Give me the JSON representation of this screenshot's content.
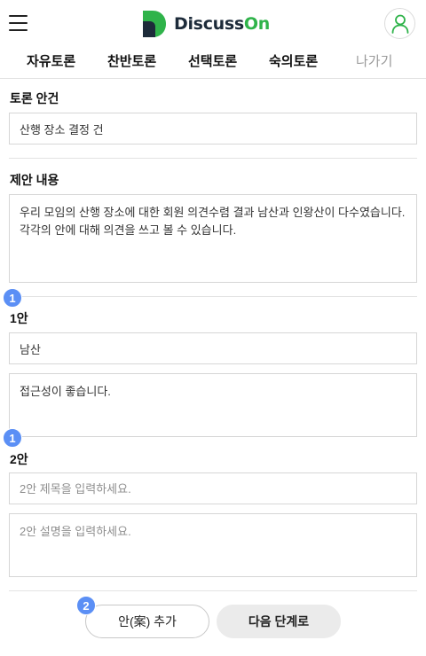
{
  "header": {
    "logo_text_main": "Discuss",
    "logo_text_accent": "On",
    "colors": {
      "brand_green": "#2fb34a",
      "brand_navy": "#1d2b3a"
    },
    "icons": {
      "menu": "hamburger-icon",
      "profile": "user-icon"
    }
  },
  "tabs": [
    {
      "label": "자유토론"
    },
    {
      "label": "찬반토론"
    },
    {
      "label": "선택토론"
    },
    {
      "label": "숙의토론"
    },
    {
      "label": "나가기"
    }
  ],
  "topic": {
    "label": "토론 안건",
    "value": "산행 장소 결정 건"
  },
  "proposal": {
    "label": "제안 내용",
    "value": "우리 모임의 산행 장소에 대한 회원 의견수렴 결과 남산과 인왕산이 다수였습니다.\n각각의 안에 대해 의견을 쓰고 볼 수 있습니다."
  },
  "options": [
    {
      "badge": "1",
      "label": "1안",
      "title_value": "남산",
      "title_placeholder": "",
      "desc_value": "접근성이 좋습니다.",
      "desc_placeholder": ""
    },
    {
      "badge": "1",
      "label": "2안",
      "title_value": "",
      "title_placeholder": "2안 제목을 입력하세요.",
      "desc_value": "",
      "desc_placeholder": "2안 설명을 입력하세요."
    }
  ],
  "footer": {
    "badge": "2",
    "add_label": "안(案) 추가",
    "next_label": "다음 단계로",
    "badge_color": "#5b8ff5"
  }
}
